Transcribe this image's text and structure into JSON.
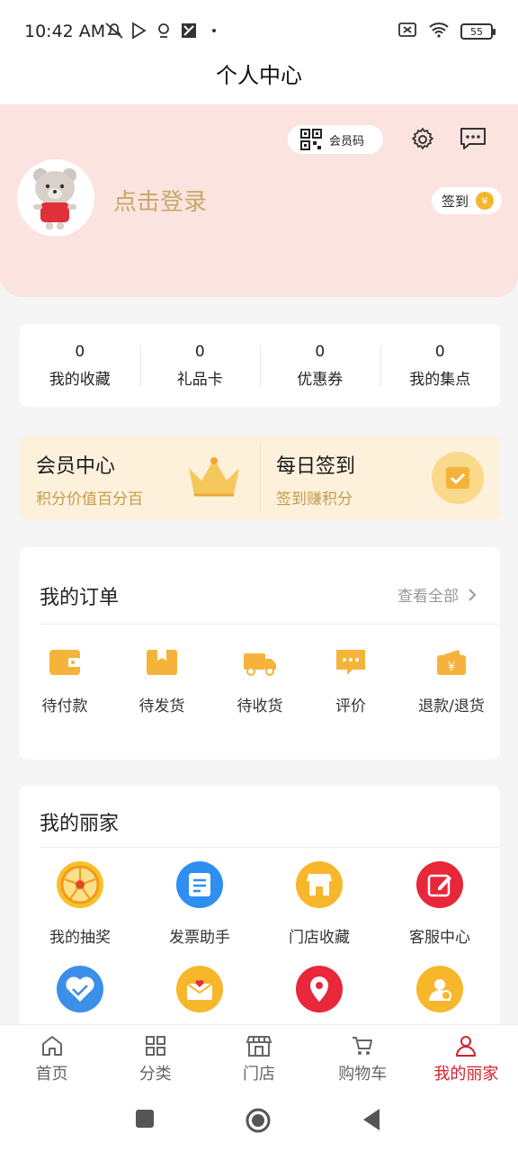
{
  "status": {
    "time": "10:42 AM",
    "battery": "55"
  },
  "header": {
    "title": "个人中心"
  },
  "profile": {
    "member_code_label": "会员码",
    "login_text": "点击登录",
    "signin_label": "签到",
    "coin_symbol": "¥"
  },
  "stats": [
    {
      "count": "0",
      "label": "我的收藏"
    },
    {
      "count": "0",
      "label": "礼品卡"
    },
    {
      "count": "0",
      "label": "优惠券"
    },
    {
      "count": "0",
      "label": "我的集点"
    }
  ],
  "promo": {
    "member_title": "会员中心",
    "member_sub": "积分价值百分百",
    "daily_title": "每日签到",
    "daily_sub": "签到赚积分"
  },
  "orders": {
    "title": "我的订单",
    "view_all": "查看全部",
    "items": [
      {
        "label": "待付款",
        "icon": "wallet-icon"
      },
      {
        "label": "待发货",
        "icon": "package-icon"
      },
      {
        "label": "待收货",
        "icon": "truck-icon"
      },
      {
        "label": "评价",
        "icon": "comment-icon"
      },
      {
        "label": "退款/退货",
        "icon": "refund-icon"
      }
    ]
  },
  "family": {
    "title": "我的丽家",
    "items": [
      {
        "label": "我的抽奖",
        "icon": "lottery-wheel-icon"
      },
      {
        "label": "发票助手",
        "icon": "invoice-icon"
      },
      {
        "label": "门店收藏",
        "icon": "store-icon"
      },
      {
        "label": "客服中心",
        "icon": "edit-icon"
      },
      {
        "label": "",
        "icon": "handshake-icon"
      },
      {
        "label": "",
        "icon": "heart-envelope-icon"
      },
      {
        "label": "",
        "icon": "location-pin-icon"
      },
      {
        "label": "",
        "icon": "user-card-icon"
      }
    ]
  },
  "tabbar": [
    {
      "label": "首页",
      "icon": "home-icon"
    },
    {
      "label": "分类",
      "icon": "grid-icon"
    },
    {
      "label": "门店",
      "icon": "store-icon"
    },
    {
      "label": "购物车",
      "icon": "cart-icon"
    },
    {
      "label": "我的丽家",
      "icon": "person-icon"
    }
  ],
  "colors": {
    "accent": "#d4202a",
    "gold": "#c69a4a",
    "profile_bg": "#fbe3df",
    "promo_bg": "#fdf1dc"
  }
}
